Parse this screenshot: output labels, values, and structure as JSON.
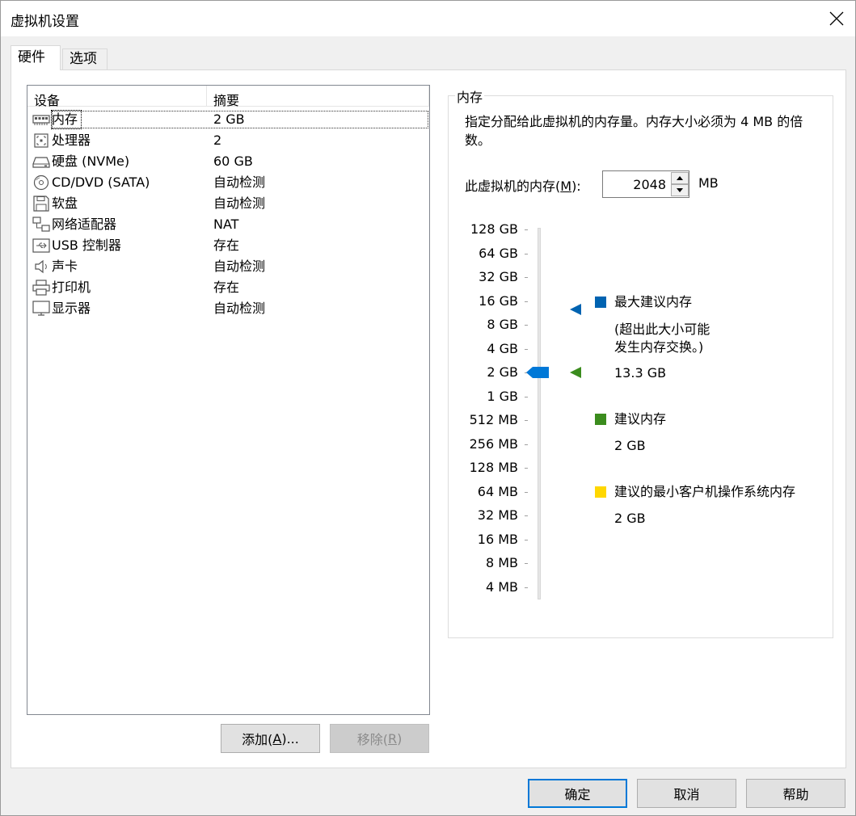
{
  "window": {
    "title": "虚拟机设置"
  },
  "tabs": [
    {
      "label": "硬件"
    },
    {
      "label": "选项"
    }
  ],
  "device_list": {
    "headers": {
      "device": "设备",
      "summary": "摘要"
    },
    "rows": [
      {
        "icon": "memory-icon",
        "name": "内存",
        "summary": "2 GB"
      },
      {
        "icon": "processor-icon",
        "name": "处理器",
        "summary": "2"
      },
      {
        "icon": "hard-disk-icon",
        "name": "硬盘 (NVMe)",
        "summary": "60 GB"
      },
      {
        "icon": "cd-dvd-icon",
        "name": "CD/DVD (SATA)",
        "summary": "自动检测"
      },
      {
        "icon": "floppy-icon",
        "name": "软盘",
        "summary": "自动检测"
      },
      {
        "icon": "network-adapter-icon",
        "name": "网络适配器",
        "summary": "NAT"
      },
      {
        "icon": "usb-icon",
        "name": "USB 控制器",
        "summary": "存在"
      },
      {
        "icon": "sound-card-icon",
        "name": "声卡",
        "summary": "自动检测"
      },
      {
        "icon": "printer-icon",
        "name": "打印机",
        "summary": "存在"
      },
      {
        "icon": "display-icon",
        "name": "显示器",
        "summary": "自动检测"
      }
    ]
  },
  "list_buttons": {
    "add": {
      "label": "添加(",
      "key": "A",
      "suffix": ")..."
    },
    "remove": {
      "label": "移除(",
      "key": "R",
      "suffix": ")"
    }
  },
  "memory": {
    "group_title": "内存",
    "description": "指定分配给此虚拟机的内存量。内存大小必须为 4 MB 的倍数。",
    "field_label_prefix": "此虚拟机的内存(",
    "field_label_key": "M",
    "field_label_suffix": "):",
    "value": "2048",
    "unit": "MB",
    "scale_labels": [
      "128 GB",
      "64 GB",
      "32 GB",
      "16 GB",
      "8 GB",
      "4 GB",
      "2 GB",
      "1 GB",
      "512 MB",
      "256 MB",
      "128 MB",
      "64 MB",
      "32 MB",
      "16 MB",
      "8 MB",
      "4 MB"
    ],
    "slider_value": "2 GB",
    "legend": {
      "max_recommended": {
        "label": "最大建议内存",
        "note_line1": "(超出此大小可能",
        "note_line2": "发生内存交换。)",
        "value": "13.3 GB",
        "color": "#0063b1"
      },
      "recommended": {
        "label": "建议内存",
        "value": "2 GB",
        "color": "#3b8c1e"
      },
      "min_guest": {
        "label": "建议的最小客户机操作系统内存",
        "value": "2 GB",
        "color": "#ffd700"
      }
    }
  },
  "footer": {
    "ok": "确定",
    "cancel": "取消",
    "help": "帮助"
  },
  "colors": {
    "accent": "#0078d7"
  }
}
